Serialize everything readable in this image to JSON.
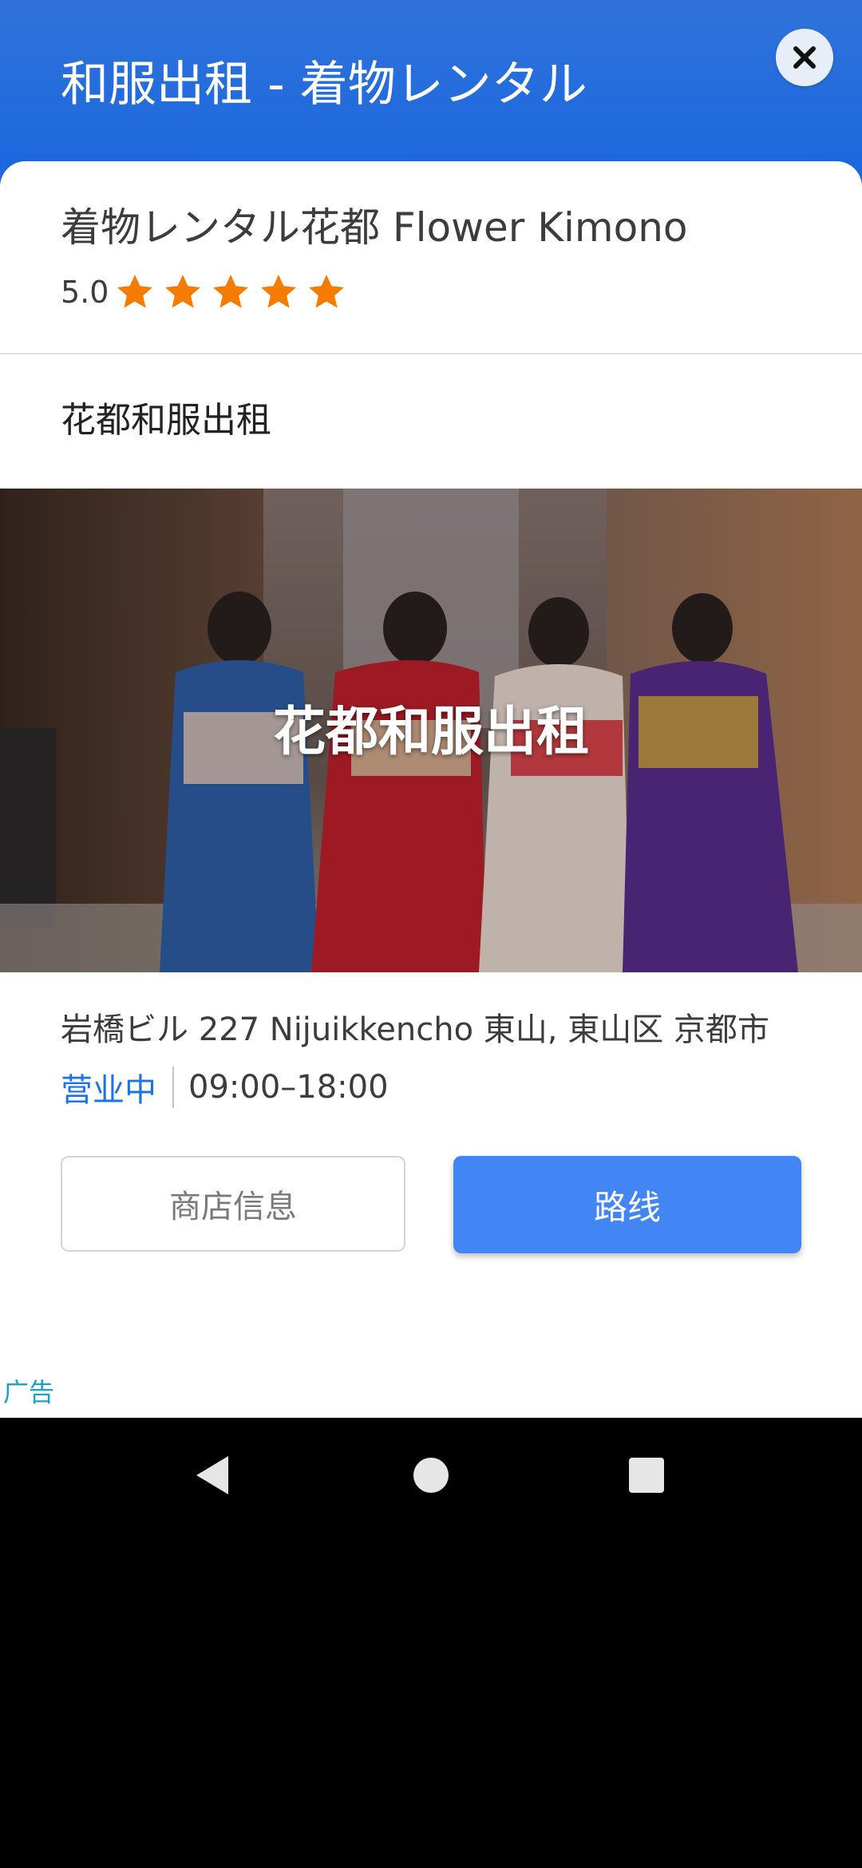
{
  "header": {
    "title": "和服出租 - 着物レンタル",
    "close_icon": "close-icon"
  },
  "business": {
    "name": "着物レンタル花都 Flower Kimono",
    "rating": "5.0",
    "stars": 5,
    "star_color": "#f57c00"
  },
  "subtitle": "花都和服出租",
  "banner": {
    "overlay_text": "花都和服出租"
  },
  "details": {
    "address": "岩橋ビル 227 Nijuikkencho 東山, 東山区 京都市",
    "open_status": "营业中",
    "hours": "09:00–18:00"
  },
  "buttons": {
    "info_label": "商店信息",
    "route_label": "路线"
  },
  "ad_label": "广告",
  "colors": {
    "header_blue": "#1a66e0",
    "accent_blue": "#4285f4",
    "open_text_blue": "#1a73e8",
    "ad_label_teal": "#1aa3c8"
  },
  "navigation": {
    "back_icon": "back-triangle-icon",
    "home_icon": "home-circle-icon",
    "recent_icon": "recent-apps-square-icon"
  }
}
